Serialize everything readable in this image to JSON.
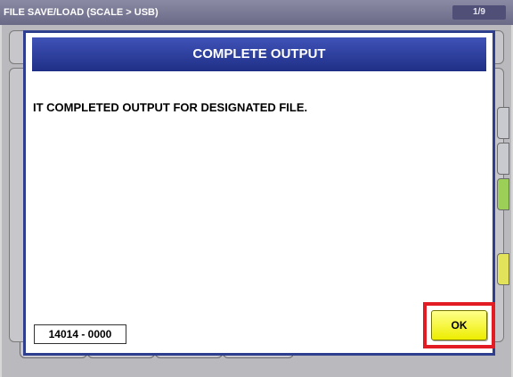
{
  "window": {
    "title": "FILE SAVE/LOAD (SCALE > USB)",
    "page_indicator": "1/9"
  },
  "dialog": {
    "title": "COMPLETE OUTPUT",
    "message": "IT COMPLETED OUTPUT FOR DESIGNATED FILE.",
    "code": "14014 - 0000",
    "ok_label": "OK"
  },
  "colors": {
    "header_blue": "#2e3f8f",
    "ok_yellow": "#eded00",
    "highlight_red": "#e31b23",
    "side_green": "#9ccf57",
    "side_yellow": "#e3e35b"
  }
}
